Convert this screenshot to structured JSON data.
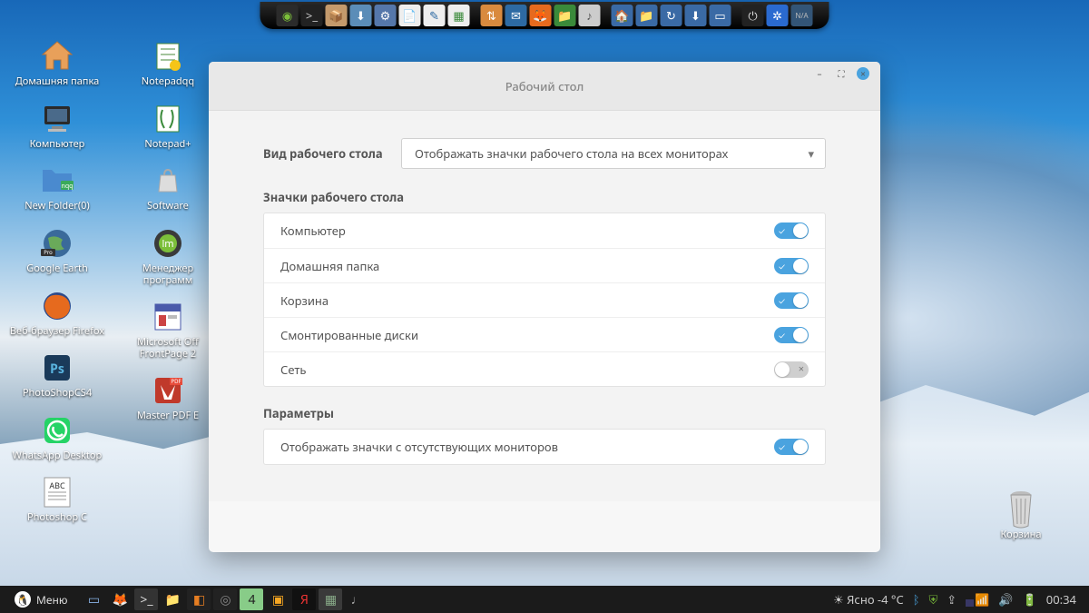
{
  "desktop_icons_col1": [
    {
      "label": "Домашняя папка",
      "glyph": "home"
    },
    {
      "label": "Компьютер",
      "glyph": "computer"
    },
    {
      "label": "New Folder(0)",
      "glyph": "folder"
    },
    {
      "label": "Google Earth",
      "glyph": "earth"
    },
    {
      "label": "Веб-браузер Firefox",
      "glyph": "firefox"
    },
    {
      "label": "PhotoShopCS4",
      "glyph": "ps"
    },
    {
      "label": "WhatsApp Desktop",
      "glyph": "whatsapp"
    }
  ],
  "desktop_icons_col2": [
    {
      "label": "Photoshop C",
      "glyph": "abc"
    },
    {
      "label": "Notepadqq",
      "glyph": "notepad"
    },
    {
      "label": "Notepad+",
      "glyph": "notepadpp"
    },
    {
      "label": "Software",
      "glyph": "bag"
    },
    {
      "label": "Менеджер программ",
      "glyph": "mint"
    },
    {
      "label": "Microsoft Off FrontPage 2",
      "glyph": "frontpage"
    },
    {
      "label": "Master PDF E",
      "glyph": "pdf"
    }
  ],
  "trash": {
    "label": "Корзина"
  },
  "window": {
    "title": "Рабочий стол",
    "view_label": "Вид рабочего стола",
    "view_value": "Отображать значки рабочего стола на всех мониторах",
    "section_icons": "Значки рабочего стола",
    "icons": [
      {
        "label": "Компьютер",
        "on": true
      },
      {
        "label": "Домашняя папка",
        "on": true
      },
      {
        "label": "Корзина",
        "on": true
      },
      {
        "label": "Смонтированные диски",
        "on": true
      },
      {
        "label": "Сеть",
        "on": false
      }
    ],
    "section_params": "Параметры",
    "params": [
      {
        "label": "Отображать значки с отсутствующих мониторов",
        "on": true
      }
    ]
  },
  "top_dock": [
    {
      "name": "mint-menu-icon",
      "bg": "#2b2b2b",
      "glyph": "◉",
      "color": "#7cbf3a"
    },
    {
      "name": "terminal-icon",
      "bg": "#222",
      "glyph": ">_",
      "color": "#ccc"
    },
    {
      "name": "package-icon",
      "bg": "#c49a6c",
      "glyph": "📦",
      "color": "#fff"
    },
    {
      "name": "download-icon",
      "bg": "#5b8db8",
      "glyph": "⬇",
      "color": "#fff"
    },
    {
      "name": "settings-icon",
      "bg": "#5577aa",
      "glyph": "⚙",
      "color": "#fff"
    },
    {
      "name": "office-icon",
      "bg": "#eee",
      "glyph": "📄",
      "color": "#333"
    },
    {
      "name": "writer-icon",
      "bg": "#eee",
      "glyph": "✎",
      "color": "#2d6aa3"
    },
    {
      "name": "calc-icon",
      "bg": "#eee",
      "glyph": "▦",
      "color": "#3a8a3a"
    },
    {
      "name": "sep",
      "bg": "",
      "glyph": "",
      "color": ""
    },
    {
      "name": "transmission-icon",
      "bg": "#d98a3e",
      "glyph": "⇅",
      "color": "#fff"
    },
    {
      "name": "thunderbird-icon",
      "bg": "#2d6aa3",
      "glyph": "✉",
      "color": "#fff"
    },
    {
      "name": "firefox-icon",
      "bg": "#e66a1e",
      "glyph": "🦊",
      "color": "#fff"
    },
    {
      "name": "files-icon",
      "bg": "#3a8a3a",
      "glyph": "📁",
      "color": "#fff"
    },
    {
      "name": "equalizer-icon",
      "bg": "#ccc",
      "glyph": "♪",
      "color": "#555"
    },
    {
      "name": "sep",
      "bg": "",
      "glyph": "",
      "color": ""
    },
    {
      "name": "home-folder-icon",
      "bg": "#3a6aa5",
      "glyph": "🏠",
      "color": "#fff"
    },
    {
      "name": "folder-icon",
      "bg": "#3a6aa5",
      "glyph": "📁",
      "color": "#fff"
    },
    {
      "name": "backup-icon",
      "bg": "#3a6aa5",
      "glyph": "↻",
      "color": "#fff"
    },
    {
      "name": "downloads-folder-icon",
      "bg": "#3a6aa5",
      "glyph": "⬇",
      "color": "#fff"
    },
    {
      "name": "folder2-icon",
      "bg": "#3a6aa5",
      "glyph": "▭",
      "color": "#fff"
    },
    {
      "name": "sep",
      "bg": "",
      "glyph": "",
      "color": ""
    },
    {
      "name": "shutdown-icon",
      "bg": "#222",
      "glyph": "⏻",
      "color": "#ddd"
    },
    {
      "name": "accessibility-icon",
      "bg": "#2a6ad0",
      "glyph": "✲",
      "color": "#fff"
    },
    {
      "name": "network-icon",
      "bg": "#335577",
      "glyph": "N/A",
      "color": "#bbb"
    }
  ],
  "panel": {
    "menu_label": "Меню",
    "tasks": [
      {
        "name": "show-desktop-icon",
        "glyph": "▭",
        "color": "#8ab4e8",
        "bg": ""
      },
      {
        "name": "firefox-task-icon",
        "glyph": "🦊",
        "color": "#e66a1e",
        "bg": ""
      },
      {
        "name": "terminal-task-icon",
        "glyph": ">_",
        "color": "#ddd",
        "bg": "#333"
      },
      {
        "name": "files-task-icon",
        "glyph": "📁",
        "color": "#5a8acf",
        "bg": ""
      },
      {
        "name": "app1-task-icon",
        "glyph": "◧",
        "color": "#e67e22",
        "bg": "#222"
      },
      {
        "name": "camera-task-icon",
        "glyph": "◎",
        "color": "#888",
        "bg": "#222"
      },
      {
        "name": "deviantart-task-icon",
        "glyph": "4",
        "color": "#222",
        "bg": "#8c8"
      },
      {
        "name": "switcher-task-icon",
        "glyph": "▣",
        "color": "#f5a623",
        "bg": ""
      },
      {
        "name": "yandex-task-icon",
        "glyph": "Я",
        "color": "#e33",
        "bg": "#111"
      },
      {
        "name": "workspace-task-icon",
        "glyph": "▦",
        "color": "#8a8",
        "bg": "#3a3a3a"
      },
      {
        "name": "sound-task-icon",
        "glyph": "♩",
        "color": "#aaa",
        "bg": ""
      }
    ],
    "weather_label": "Ясно -4 °C",
    "clock": "00:34"
  }
}
